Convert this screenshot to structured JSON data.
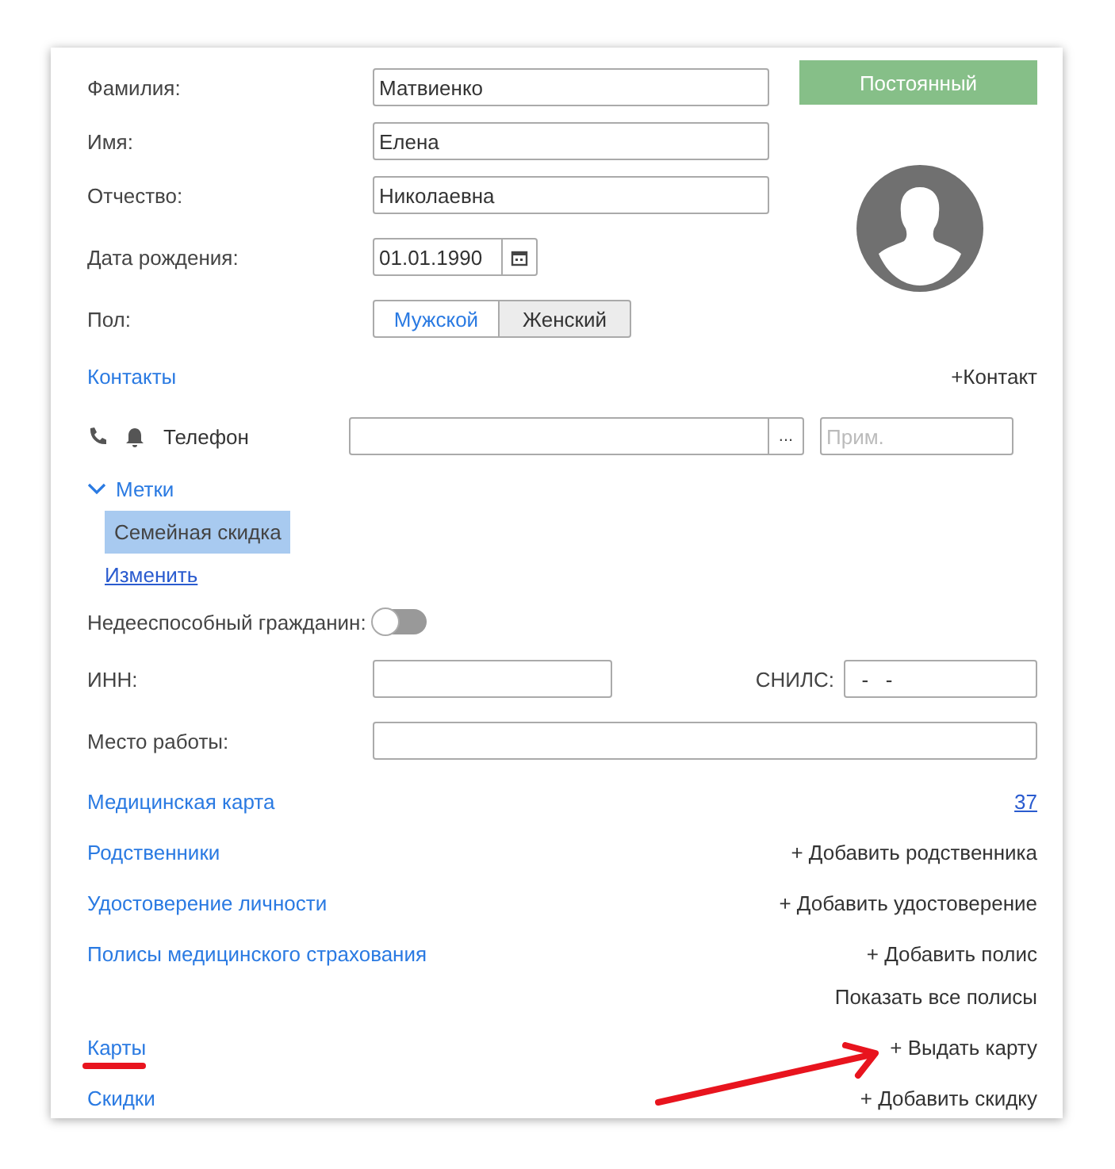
{
  "person_fields": [
    {
      "label": "Фамилия:",
      "value": "Матвиенко"
    },
    {
      "label": "Имя:",
      "value": "Елена"
    },
    {
      "label": "Отчество:",
      "value": "Николаевна"
    }
  ],
  "status_button": "Постоянный",
  "birth_date": {
    "label": "Дата рождения:",
    "value": "01.01.1990"
  },
  "gender": {
    "label": "Пол:",
    "options": [
      {
        "label": "Мужской",
        "selected": false
      },
      {
        "label": "Женский",
        "selected": true
      }
    ]
  },
  "contacts": {
    "title": "Контакты",
    "add": "+Контакт",
    "phone": {
      "label": "Телефон",
      "more": "...",
      "note_placeholder": "Прим."
    }
  },
  "tags": {
    "title": "Метки",
    "expanded": true,
    "items": [
      "Семейная скидка"
    ],
    "edit": "Изменить"
  },
  "incapable": {
    "label": "Недееспособный гражданин:",
    "on": false
  },
  "inn": {
    "label": "ИНН:"
  },
  "snils": {
    "label": "СНИЛС:",
    "value": "  -   -"
  },
  "workplace": {
    "label": "Место работы:"
  },
  "sections": [
    {
      "title": "Медицинская карта",
      "highlighted": false,
      "actions": [
        {
          "kind": "count",
          "label": "37",
          "pointed": false
        }
      ]
    },
    {
      "title": "Родственники",
      "highlighted": false,
      "actions": [
        {
          "kind": "add",
          "label": "+ Добавить родственника",
          "pointed": false
        }
      ]
    },
    {
      "title": "Удостоверение личности",
      "highlighted": false,
      "actions": [
        {
          "kind": "add",
          "label": "+ Добавить удостоверение",
          "pointed": false
        }
      ]
    },
    {
      "title": "Полисы медицинского страхования",
      "highlighted": false,
      "actions": [
        {
          "kind": "add",
          "label": "+ Добавить полис",
          "pointed": false
        },
        {
          "kind": "add",
          "label": "Показать все полисы",
          "pointed": false
        }
      ]
    },
    {
      "title": "Карты",
      "highlighted": true,
      "actions": [
        {
          "kind": "add",
          "label": "+ Выдать карту",
          "pointed": true
        }
      ]
    },
    {
      "title": "Скидки",
      "highlighted": false,
      "actions": [
        {
          "kind": "add",
          "label": "+ Добавить скидку",
          "pointed": false
        }
      ]
    }
  ]
}
